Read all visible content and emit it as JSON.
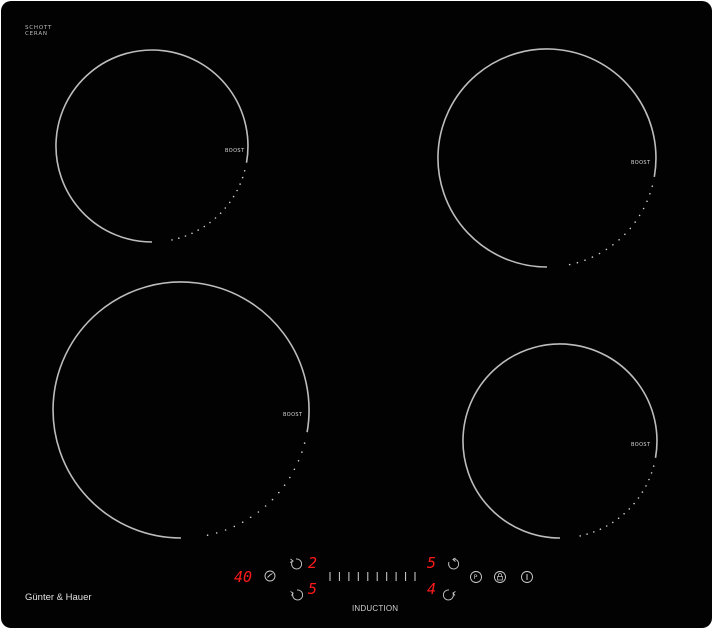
{
  "panel": {
    "logo_top_line1": "SCHOTT",
    "logo_top_line2": "CERAN",
    "brand": "Günter & Hauer",
    "induction_label": "INDUCTION"
  },
  "zones": {
    "top_left": {
      "boost_label": "BOOST"
    },
    "top_right": {
      "boost_label": "BOOST"
    },
    "bottom_left": {
      "boost_label": "BOOST"
    },
    "bottom_right": {
      "boost_label": "BOOST"
    }
  },
  "controls": {
    "timer_display": "40",
    "left_top_level": "2",
    "left_bottom_level": "5",
    "right_top_level": "5",
    "right_bottom_level": "4",
    "pause_glyph": "P",
    "lock_glyph": "▲",
    "power_glyph": "I"
  },
  "colors": {
    "glass": "#020202",
    "ring": "#bdbdbd",
    "display_red": "#ff1a1a"
  },
  "icons": [
    "timer-icon",
    "zone-select-icon",
    "slider-icon",
    "pause-icon",
    "lock-icon",
    "power-icon"
  ]
}
